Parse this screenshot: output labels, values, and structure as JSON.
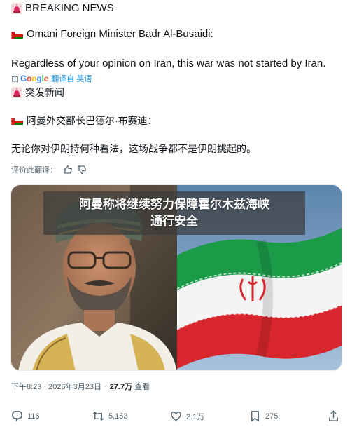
{
  "tweet": {
    "line1": "BREAKING NEWS",
    "line2": "Omani Foreign Minister Badr Al-Busaidi:",
    "line3": "Regardless of your opinion on Iran, this war was not started by Iran.",
    "translated_by": "由",
    "google": "Google",
    "translate_label": "翻译自 英语",
    "line4": "突发新闻",
    "line5": "阿曼外交部长巴德尔·布赛迪：",
    "line6": "无论你对伊朗持何种看法，这场战争都不是伊朗挑起的。",
    "rate_label": "评价此翻译："
  },
  "media": {
    "caption_line1": "阿曼称将继续努力保障霍尔木兹海峡",
    "caption_line2": "通行安全"
  },
  "meta": {
    "time": "下午8:23 · 2026年3月23日",
    "views_count": "27.7万",
    "views_label": "查看"
  },
  "actions": {
    "replies": "116",
    "retweets": "5,153",
    "likes": "2.1万",
    "bookmarks": "275"
  },
  "colors": {
    "link": "#1d9bf0",
    "secondary_text": "#536471",
    "primary_text": "#0f1419"
  },
  "icons": [
    "siren-icon",
    "oman-flag-icon",
    "thumbs-up-icon",
    "thumbs-down-icon",
    "reply-icon",
    "retweet-icon",
    "like-icon",
    "bookmark-icon",
    "share-icon"
  ]
}
